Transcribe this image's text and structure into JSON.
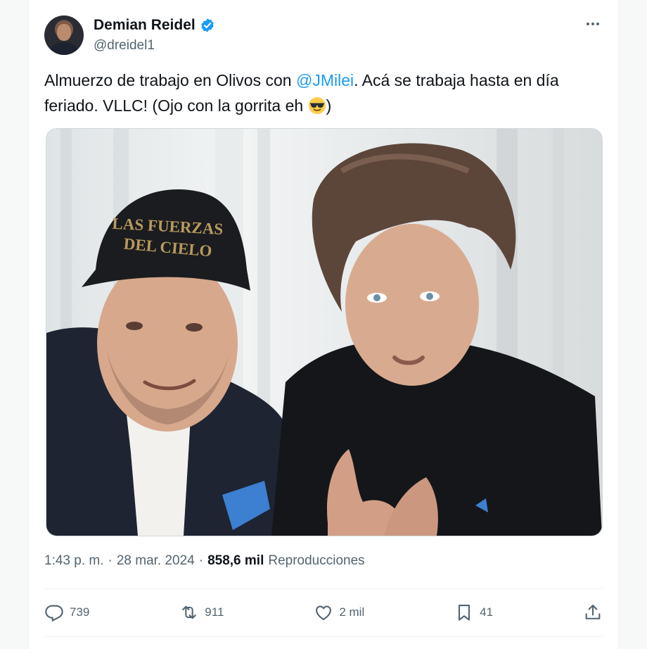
{
  "author": {
    "name": "Demian Reidel",
    "handle": "@dreidel1"
  },
  "tweet": {
    "text_before": "Almuerzo de trabajo en Olivos con ",
    "mention": "@JMilei",
    "text_after": ". Acá se trabaja hasta en día feriado. VLLC! (Ojo con la gorrita eh ",
    "emoji": "sunglasses-emoji",
    "text_end": ")"
  },
  "photo": {
    "cap_line1": "LAS FUERZAS",
    "cap_line2": "DEL CIELO"
  },
  "meta": {
    "time": "1:43 p. m.",
    "separator": "·",
    "date": "28 mar. 2024",
    "views_count": "858,6 mil",
    "views_label": "Reproducciones"
  },
  "actions": {
    "replies": "739",
    "reposts": "911",
    "likes": "2 mil",
    "bookmarks": "41"
  },
  "icons": {
    "verified": "verified-badge-icon",
    "more": "more-icon",
    "reply": "reply-icon",
    "repost": "repost-icon",
    "like": "like-icon",
    "bookmark": "bookmark-icon",
    "share": "share-icon"
  },
  "colors": {
    "accent": "#1d9bf0",
    "secondary_text": "#536471",
    "primary_text": "#0f1419"
  }
}
